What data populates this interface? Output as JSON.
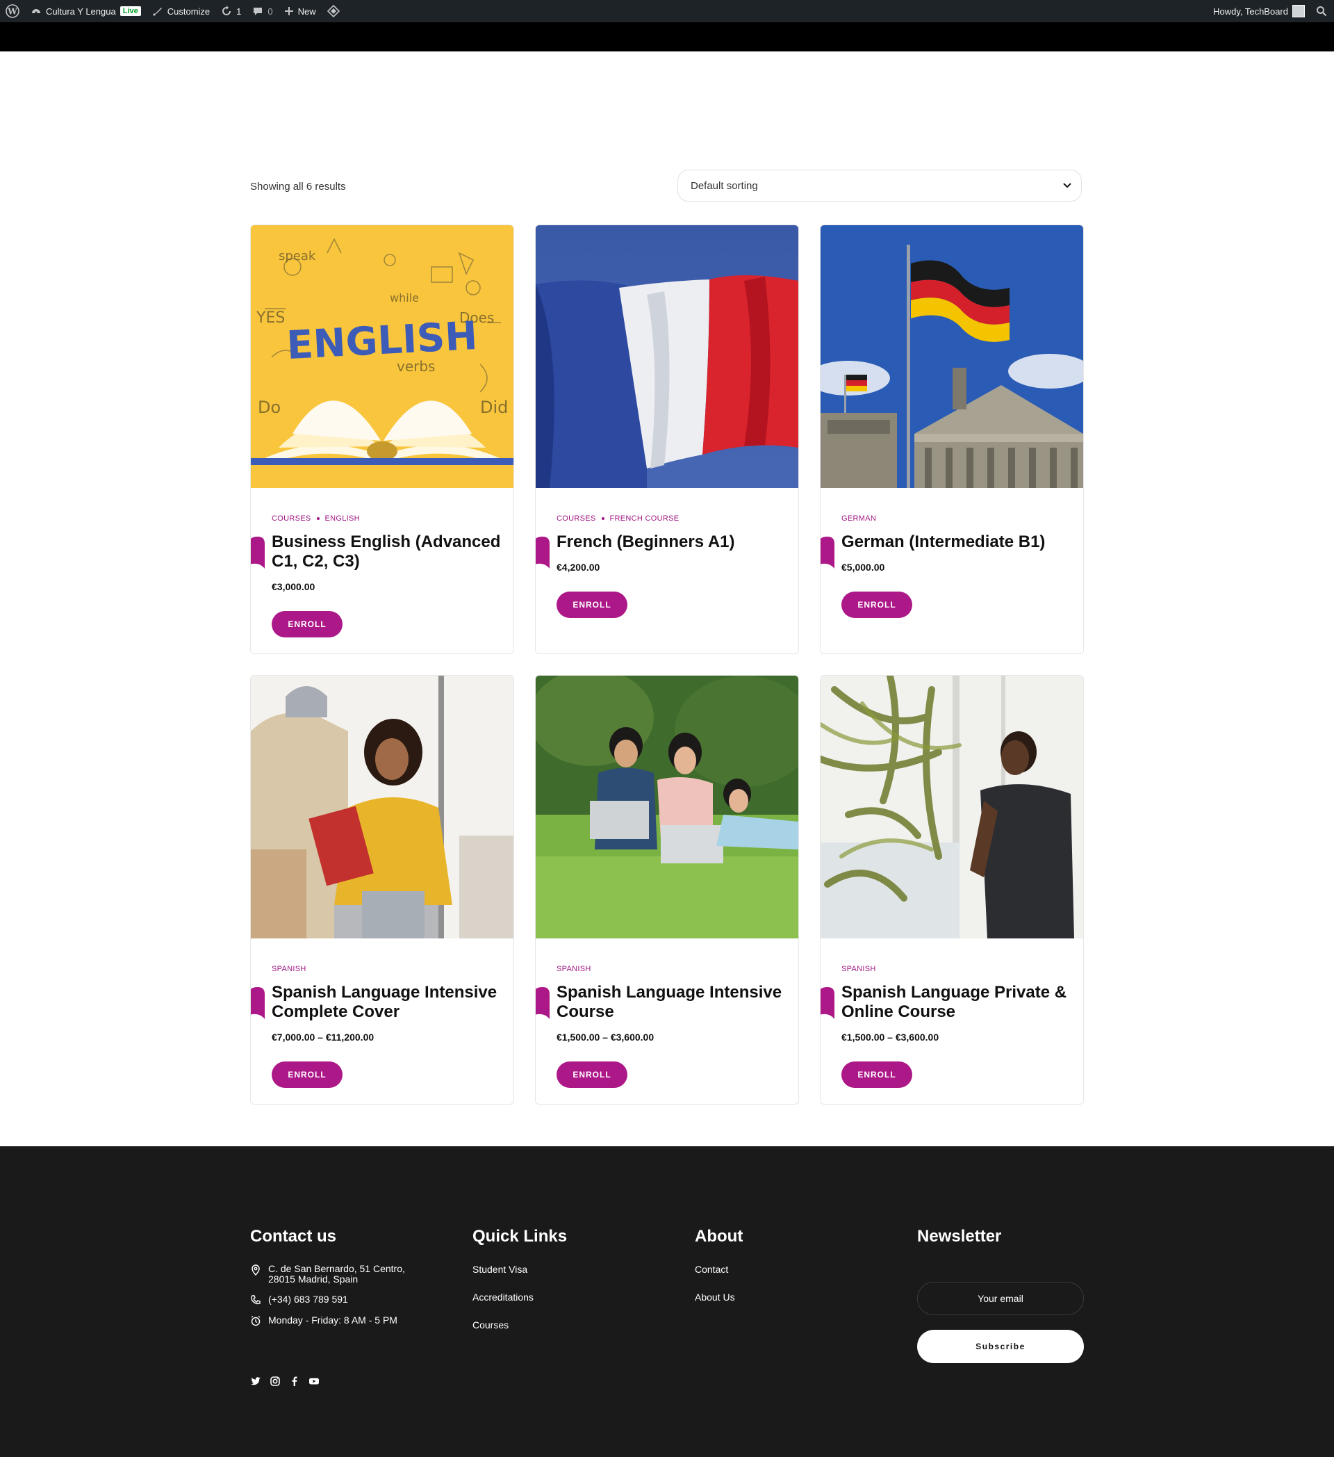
{
  "adminbar": {
    "site_name": "Cultura Y Lengua",
    "live_badge": "Live",
    "customize": "Customize",
    "updates_count": "1",
    "comments_count": "0",
    "new_label": "New",
    "howdy": "Howdy, TechBoard"
  },
  "shop": {
    "result_count": "Showing all 6 results",
    "sorting_selected": "Default sorting"
  },
  "products": [
    {
      "categories": [
        "Courses",
        "English"
      ],
      "title": "Business English (Advanced C1, C2, C3)",
      "price": "€3,000.00",
      "button": "Enroll",
      "image": "english-book-illustration"
    },
    {
      "categories": [
        "Courses",
        "French Course"
      ],
      "title": "French (Beginners A1)",
      "price": "€4,200.00",
      "button": "Enroll",
      "image": "french-flag"
    },
    {
      "categories": [
        "German"
      ],
      "title": "German (Intermediate B1)",
      "price": "€5,000.00",
      "button": "Enroll",
      "image": "german-flag-reichstag"
    },
    {
      "categories": [
        "Spanish"
      ],
      "title": "Spanish Language Intensive Complete Cover",
      "price": "€7,000.00 – €11,200.00",
      "button": "Enroll",
      "image": "student-with-books"
    },
    {
      "categories": [
        "Spanish"
      ],
      "title": "Spanish Language Intensive Course",
      "price": "€1,500.00 – €3,600.00",
      "button": "Enroll",
      "image": "students-on-grass-laptops"
    },
    {
      "categories": [
        "Spanish"
      ],
      "title": "Spanish Language Private & Online Course",
      "price": "€1,500.00 – €3,600.00",
      "button": "Enroll",
      "image": "student-by-window"
    }
  ],
  "footer": {
    "contact": {
      "heading": "Contact us",
      "address_line1": "C. de San Bernardo, 51 Centro,",
      "address_line2": "28015 Madrid, Spain",
      "phone": "(+34) 683 789 591",
      "hours": "Monday - Friday: 8 AM - 5 PM",
      "social_icons": [
        "twitter-icon",
        "instagram-icon",
        "facebook-icon",
        "youtube-icon"
      ]
    },
    "quick_links": {
      "heading": "Quick Links",
      "links": [
        "Student Visa",
        "Accreditations",
        "Courses"
      ]
    },
    "about": {
      "heading": "About",
      "links": [
        "Contact",
        "About Us"
      ]
    },
    "newsletter": {
      "heading": "Newsletter",
      "placeholder": "Your email",
      "button": "Subscribe"
    }
  },
  "colors": {
    "accent": "#ad1889",
    "footer_bg": "#1a1a1a",
    "adminbar_bg": "#1d2327"
  }
}
